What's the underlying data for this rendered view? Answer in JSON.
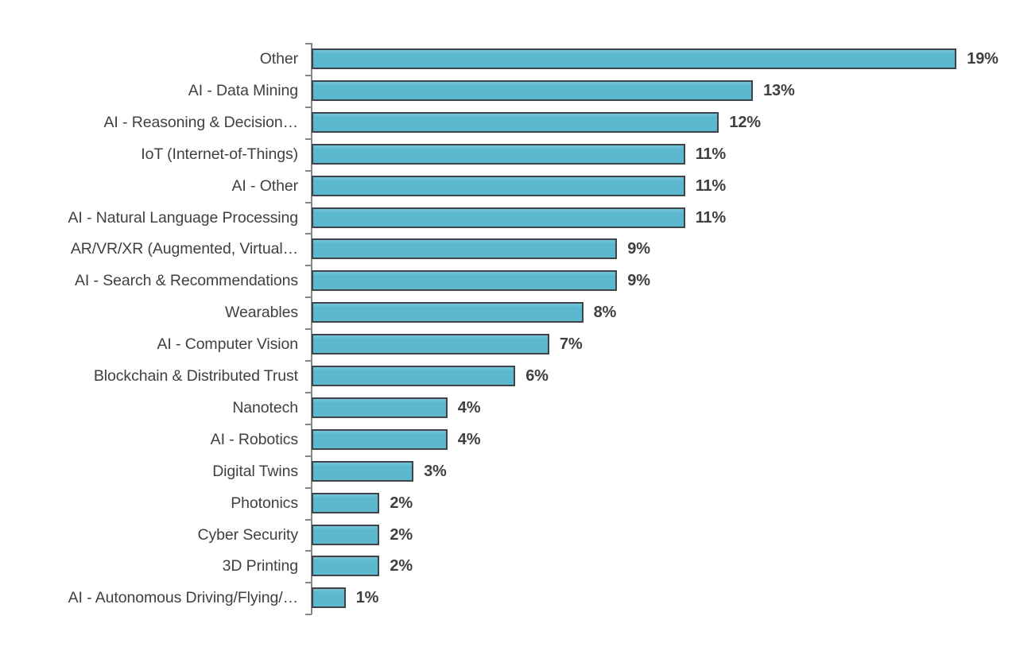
{
  "chart_data": {
    "type": "bar",
    "orientation": "horizontal",
    "title": "",
    "subtitle": "",
    "xlabel": "",
    "ylabel": "",
    "grid": false,
    "legend": null,
    "legend_position": "none",
    "axis_visible": "category-axis-only",
    "value_format": "percent-integer",
    "xlim": [
      0,
      19
    ],
    "categories": [
      "Other",
      "AI - Data Mining",
      "AI - Reasoning & Decision…",
      "IoT (Internet-of-Things)",
      "AI - Other",
      "AI - Natural Language Processing",
      "AR/VR/XR (Augmented, Virtual…",
      "AI - Search & Recommendations",
      "Wearables",
      "AI - Computer Vision",
      "Blockchain & Distributed Trust",
      "Nanotech",
      "AI - Robotics",
      "Digital Twins",
      "Photonics",
      "Cyber Security",
      "3D Printing",
      "AI - Autonomous Driving/Flying/…"
    ],
    "values": [
      19,
      13,
      12,
      11,
      11,
      11,
      9,
      9,
      8,
      7,
      6,
      4,
      4,
      3,
      2,
      2,
      2,
      1
    ],
    "value_labels": [
      "19%",
      "13%",
      "12%",
      "11%",
      "11%",
      "11%",
      "9%",
      "9%",
      "8%",
      "7%",
      "6%",
      "4%",
      "4%",
      "3%",
      "2%",
      "2%",
      "2%",
      "1%"
    ]
  },
  "style": {
    "bar_fill": "#5cb8ce",
    "bar_border": "#404448",
    "text_color": "#404040",
    "axis_color": "#868686",
    "background": "#ffffff"
  }
}
